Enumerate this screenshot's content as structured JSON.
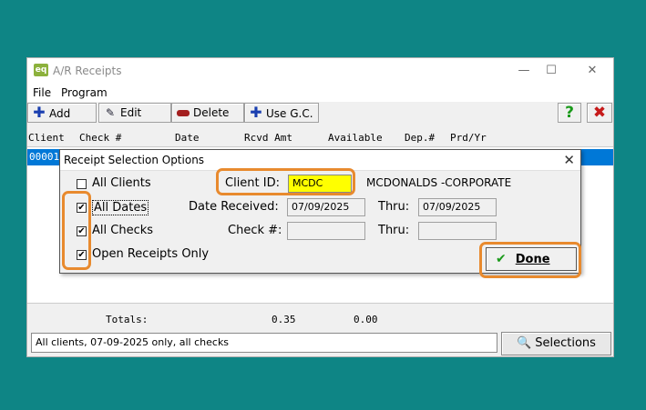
{
  "window": {
    "title": "A/R Receipts",
    "app_icon_text": "eq",
    "minimize": "—",
    "maximize": "☐",
    "close": "✕"
  },
  "menu": {
    "file": "File",
    "program": "Program"
  },
  "toolbar": {
    "add": "Add",
    "edit": "Edit",
    "delete": "Delete",
    "use_gc": "Use G.C.",
    "help": "?",
    "exit": "✖"
  },
  "columns": [
    "Client",
    "Check #",
    "Date",
    "Rcvd Amt",
    "Available",
    "Dep.#",
    "Prd/Yr"
  ],
  "selected_row": {
    "client": "00001"
  },
  "totals": {
    "label": "Totals:",
    "rcvd": "0.35",
    "available": "0.00"
  },
  "status_text": "All clients, 07-09-2025 only, all checks",
  "selections_button": "Selections",
  "dialog": {
    "title": "Receipt Selection Options",
    "close": "✕",
    "all_clients": {
      "label": "All Clients",
      "checked": false
    },
    "all_dates": {
      "label": "All Dates",
      "checked": true
    },
    "all_checks": {
      "label": "All Checks",
      "checked": true
    },
    "open_only": {
      "label": "Open Receipts Only",
      "checked": true
    },
    "client_id_label": "Client ID:",
    "client_id_value": "MCDC",
    "client_name": "MCDONALDS -CORPORATE",
    "date_received_label": "Date Received:",
    "date_received_value": "07/09/2025",
    "thru_label": "Thru:",
    "thru_date_value": "07/09/2025",
    "check_label": "Check #:",
    "check_value": "",
    "thru_check_label": "Thru:",
    "thru_check_value": "",
    "done_button": "Done",
    "check_mark": "✔"
  },
  "colors": {
    "background": "#0e8585",
    "highlight": "#e88a2e",
    "client_id_bg": "#ffff00",
    "selection_blue": "#0078d7"
  }
}
